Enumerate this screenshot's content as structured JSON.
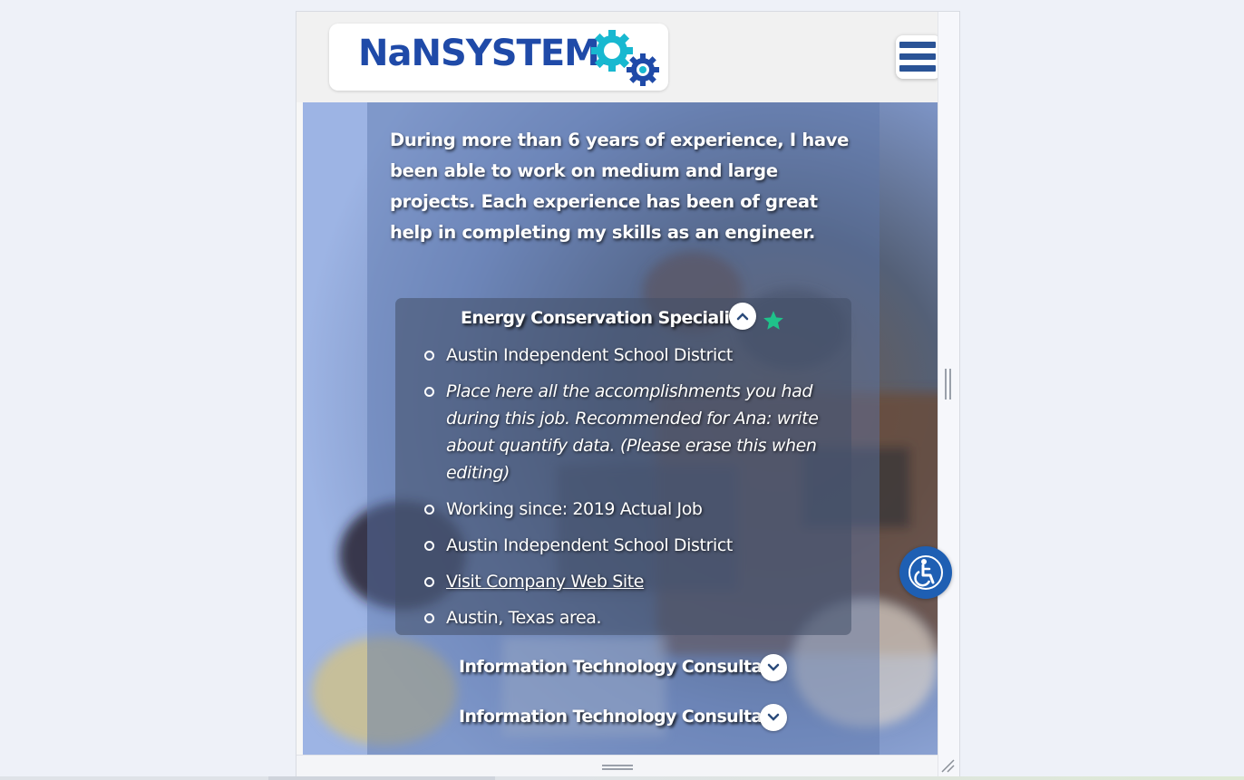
{
  "brand": {
    "name": "NaNSYSTEMS",
    "logo_icon": "gears-icon",
    "primary_color": "#1f4aa8",
    "accent_color": "#18b8d0"
  },
  "nav": {
    "menu_icon": "hamburger-menu-icon"
  },
  "intro": {
    "text": "During more than 6 years of experience, I have been able to work on medium and large projects. Each experience has been of great help in completing my skills as an engineer."
  },
  "experience": {
    "expanded": {
      "title": "Energy Conservation Specialist",
      "toggle_icon": "chevron-up-icon",
      "badge_icon": "star-icon",
      "badge_color": "#1fc28a",
      "details": {
        "company": "Austin Independent School District",
        "accomplishments": "Place here all the accomplishments you had during this job. Recommended for Ana: write about quantify data. (Please erase this when editing)",
        "working_since": "Working since: 2019 Actual Job",
        "company_repeat": "Austin Independent School District",
        "website_link": "Visit Company Web Site",
        "location": "Austin, Texas area."
      }
    },
    "collapsed": [
      {
        "title": "Information Technology Consultant",
        "toggle_icon": "chevron-down-icon"
      },
      {
        "title": "Information Technology Consultant",
        "toggle_icon": "chevron-down-icon"
      }
    ]
  },
  "accessibility": {
    "icon": "accessibility-icon",
    "color": "#1e5fb3"
  }
}
